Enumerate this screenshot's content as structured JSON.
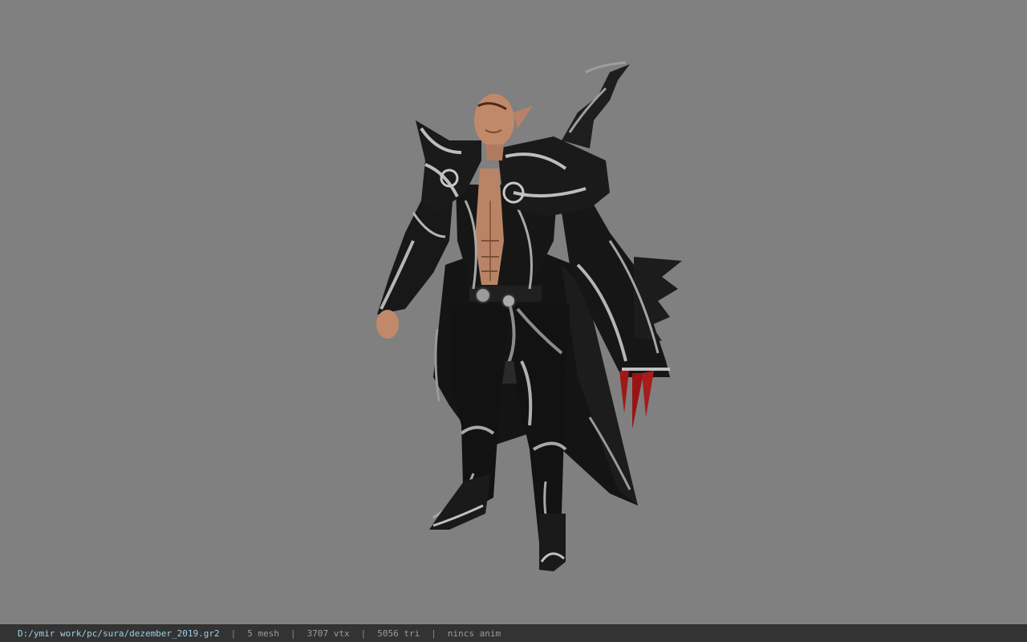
{
  "statusbar": {
    "file_path": "D:/ymir work/pc/sura/dezember_2019.gr2",
    "separator": "|",
    "mesh_count": "5 mesh",
    "vertex_count": "3707 vtx",
    "triangle_count": "5056 tri",
    "animation": "nincs anim"
  },
  "colors": {
    "viewport_background": "#808080",
    "statusbar_background": "#333333",
    "path_text": "#9fd0e8",
    "stat_text": "#9c9c9c",
    "armor_black": "#151515",
    "armor_silver": "#b8b8b8",
    "claw_red": "#a01818",
    "skin": "#c08a6a"
  }
}
